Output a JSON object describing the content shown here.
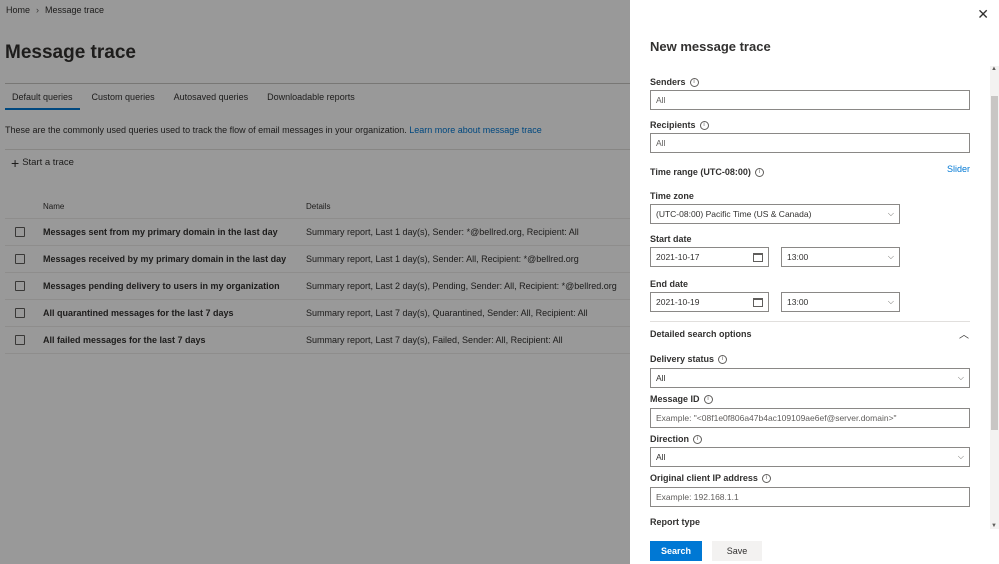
{
  "breadcrumb": {
    "home": "Home",
    "current": "Message trace"
  },
  "page": {
    "title": "Message trace",
    "tabs": [
      {
        "label": "Default queries"
      },
      {
        "label": "Custom queries"
      },
      {
        "label": "Autosaved queries"
      },
      {
        "label": "Downloadable reports"
      }
    ],
    "description": "These are the commonly used queries used to track the flow of email messages in your organization.",
    "learn_more": "Learn more about message trace",
    "start_trace": "Start a trace",
    "table": {
      "headers": {
        "name": "Name",
        "details": "Details"
      },
      "rows": [
        {
          "name": "Messages sent from my primary domain in the last day",
          "details": "Summary report, Last 1 day(s), Sender: *@bellred.org, Recipient: All"
        },
        {
          "name": "Messages received by my primary domain in the last day",
          "details": "Summary report, Last 1 day(s), Sender: All, Recipient: *@bellred.org"
        },
        {
          "name": "Messages pending delivery to users in my organization",
          "details": "Summary report, Last 2 day(s), Pending, Sender: All, Recipient: *@bellred.org"
        },
        {
          "name": "All quarantined messages for the last 7 days",
          "details": "Summary report, Last 7 day(s), Quarantined, Sender: All, Recipient: All"
        },
        {
          "name": "All failed messages for the last 7 days",
          "details": "Summary report, Last 7 day(s), Failed, Sender: All, Recipient: All"
        }
      ]
    }
  },
  "panel": {
    "title": "New message trace",
    "senders": {
      "label": "Senders",
      "placeholder": "All"
    },
    "recipients": {
      "label": "Recipients",
      "placeholder": "All"
    },
    "time_range": {
      "label": "Time range (UTC-08:00)",
      "slider": "Slider"
    },
    "time_zone": {
      "label": "Time zone",
      "value": "(UTC-08:00) Pacific Time (US & Canada)"
    },
    "start_date": {
      "label": "Start date",
      "date": "2021-10-17",
      "time": "13:00"
    },
    "end_date": {
      "label": "End date",
      "date": "2021-10-19",
      "time": "13:00"
    },
    "detailed": {
      "label": "Detailed search options"
    },
    "delivery_status": {
      "label": "Delivery status",
      "value": "All"
    },
    "message_id": {
      "label": "Message ID",
      "placeholder": "Example: \"<08f1e0f806a47b4ac109109ae6ef@server.domain>\""
    },
    "direction": {
      "label": "Direction",
      "value": "All"
    },
    "client_ip": {
      "label": "Original client IP address",
      "placeholder": "Example: 192.168.1.1"
    },
    "report_type": {
      "label": "Report type"
    },
    "search_button": "Search",
    "save_button": "Save"
  }
}
